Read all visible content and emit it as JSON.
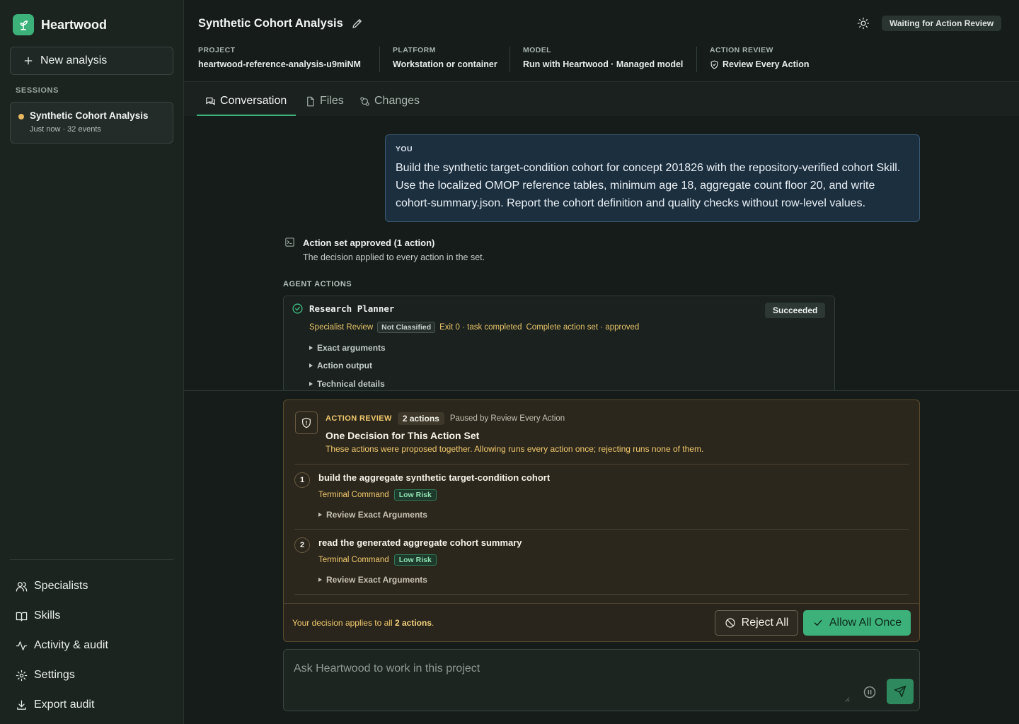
{
  "app": {
    "name": "Heartwood"
  },
  "sidebar": {
    "new_button": "New analysis",
    "sessions_label": "SESSIONS",
    "session": {
      "title": "Synthetic Cohort Analysis",
      "subtitle": "Just now · 32 events",
      "status_color": "#e9b860"
    },
    "nav": [
      {
        "label": "Specialists",
        "icon": "users-icon"
      },
      {
        "label": "Skills",
        "icon": "book-icon"
      },
      {
        "label": "Activity & audit",
        "icon": "activity-icon"
      },
      {
        "label": "Settings",
        "icon": "gear-icon"
      },
      {
        "label": "Export audit",
        "icon": "download-icon"
      }
    ]
  },
  "header": {
    "title": "Synthetic Cohort Analysis",
    "status": "Waiting for Action Review",
    "meta": [
      {
        "label": "PROJECT",
        "value": "heartwood-reference-analysis-u9miNM"
      },
      {
        "label": "PLATFORM",
        "value": "Workstation or container"
      },
      {
        "label": "MODEL",
        "value": "Run with Heartwood · Managed model"
      },
      {
        "label": "ACTION REVIEW",
        "value": "Review Every Action"
      }
    ]
  },
  "tabs": [
    {
      "label": "Conversation",
      "active": true
    },
    {
      "label": "Files",
      "active": false
    },
    {
      "label": "Changes",
      "active": false
    }
  ],
  "conversation": {
    "user_label": "YOU",
    "user_message": "Build the synthetic target-condition cohort for concept 201826 with the repository-verified cohort Skill. Use the localized OMOP reference tables, minimum age 18, aggregate count floor 20, and write cohort-summary.json. Report the cohort definition and quality checks without row-level values.",
    "approved_title": "Action set approved (1 action)",
    "approved_sub": "The decision applied to every action in the set.",
    "agent_actions_label": "AGENT ACTIONS",
    "agent": {
      "name": "Research Planner",
      "status": "Succeeded",
      "tag_review": "Specialist Review",
      "tag_class": "Not Classified",
      "tag_exit": "Exit 0 · task completed",
      "tag_set": "Complete action set · approved",
      "disclosures": [
        "Exact arguments",
        "Action output",
        "Technical details"
      ]
    }
  },
  "review": {
    "kicker": "ACTION REVIEW",
    "count": "2 actions",
    "paused": "Paused by Review Every Action",
    "title": "One Decision for This Action Set",
    "description": "These actions were proposed together. Allowing runs every action once; rejecting runs none of them.",
    "items": [
      {
        "num": "1",
        "title": "build the aggregate synthetic target-condition cohort",
        "kind": "Terminal Command",
        "risk": "Low Risk",
        "disclosure": "Review Exact Arguments"
      },
      {
        "num": "2",
        "title": "read the generated aggregate cohort summary",
        "kind": "Terminal Command",
        "risk": "Low Risk",
        "disclosure": "Review Exact Arguments"
      }
    ],
    "footer_prefix": "Your decision applies to all",
    "footer_bold": "2 actions",
    "footer_suffix": ".",
    "reject_label": "Reject All",
    "allow_label": "Allow All Once"
  },
  "composer": {
    "placeholder": "Ask Heartwood to work in this project"
  },
  "colors": {
    "accent": "#3cb27a",
    "warning": "#f1c96c",
    "background": "#151c19"
  }
}
